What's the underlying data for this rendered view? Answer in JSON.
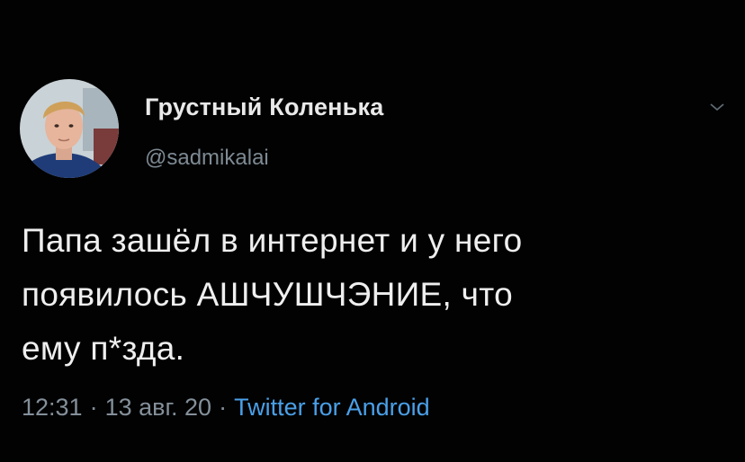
{
  "tweet": {
    "author": {
      "display_name": "Грустный Коленька",
      "handle": "@sadmikalai",
      "avatar_icon": "profile-photo"
    },
    "menu_icon": "chevron-down-icon",
    "text": "Папа зашёл в интернет и у него\nпоявилось АШЧУШЧЭНИЕ, что\nему п*зда.",
    "meta": {
      "time": "12:31",
      "separator": "·",
      "date": "13 авг. 20",
      "source": "Twitter for Android"
    }
  },
  "colors": {
    "background": "#020202",
    "text": "#efefef",
    "muted": "#84909a",
    "link": "#4aa0e8"
  }
}
